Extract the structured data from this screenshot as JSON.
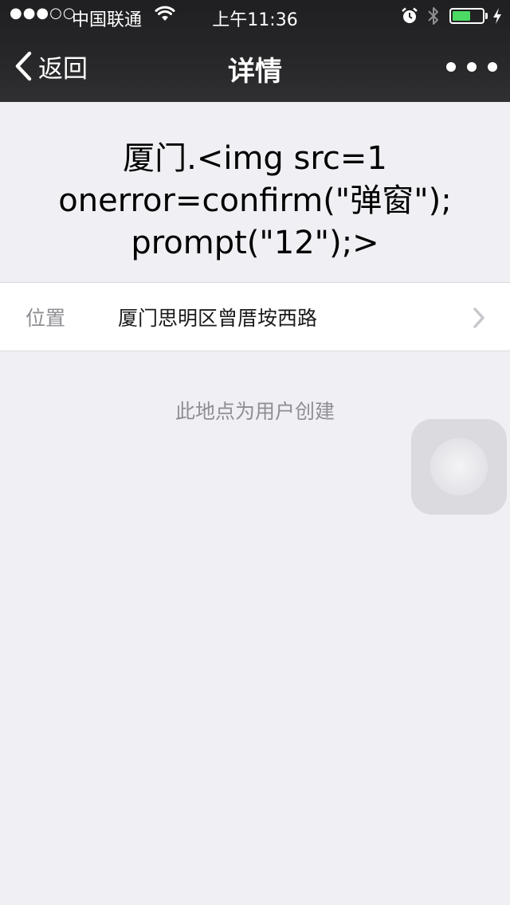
{
  "status_bar": {
    "signal": "●●●○○",
    "carrier": "中国联通",
    "time": "上午11:36",
    "battery_level": 0.6,
    "battery_color": "#4cd964"
  },
  "nav": {
    "back_label": "返回",
    "title": "详情",
    "more_icon": "more-dots-icon"
  },
  "place": {
    "title": "厦门.<img src=1\nonerror=confirm(\"弹窗\");\nprompt(\"12\");>"
  },
  "location": {
    "label": "位置",
    "value": "厦门思明区曾厝垵西路"
  },
  "note": "此地点为用户创建",
  "colors": {
    "background": "#efeff4",
    "nav_background": "#29292b",
    "secondary_text": "#8e8e93"
  }
}
